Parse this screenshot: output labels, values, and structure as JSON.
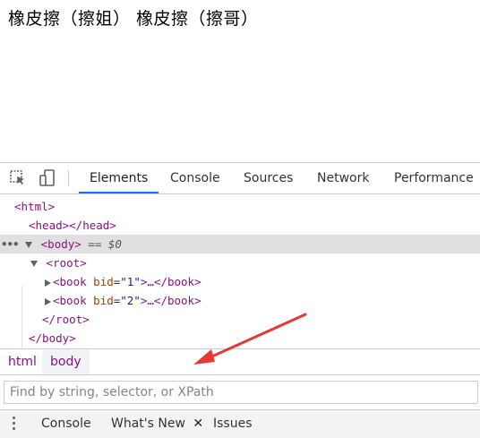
{
  "page": {
    "text": "橡皮擦（擦姐） 橡皮擦（擦哥）"
  },
  "devtools": {
    "tabs": [
      {
        "label": "Elements",
        "active": true
      },
      {
        "label": "Console"
      },
      {
        "label": "Sources"
      },
      {
        "label": "Network"
      },
      {
        "label": "Performance"
      }
    ],
    "icons": [
      "inspect-element-icon",
      "device-toolbar-icon"
    ],
    "dom": {
      "html_open": "<html>",
      "head": "<head></head>",
      "body_open": "<body>",
      "body_eq": "== $0",
      "root_open": "<root>",
      "book1": {
        "open": "<book",
        "attr": "bid",
        "value": "\"1\"",
        "ellipsis": ">…",
        "close": "</book>"
      },
      "book2": {
        "open": "<book",
        "attr": "bid",
        "value": "\"2\"",
        "ellipsis": ">…",
        "close": "</book>"
      },
      "root_close": "</root>",
      "body_close": "</body>"
    },
    "breadcrumbs": [
      {
        "label": "html"
      },
      {
        "label": "body",
        "active": true
      }
    ],
    "find_placeholder": "Find by string, selector, or XPath",
    "drawer": {
      "tabs": [
        {
          "label": "Console"
        },
        {
          "label": "What's New",
          "closable": true
        },
        {
          "label": "Issues"
        }
      ],
      "close_glyph": "✕"
    },
    "colors": {
      "accent": "#1a73e8",
      "tag": "#881280",
      "attr_name": "#994500",
      "attr_value": "#1a1aa6",
      "annotation_arrow": "#e53935"
    }
  }
}
